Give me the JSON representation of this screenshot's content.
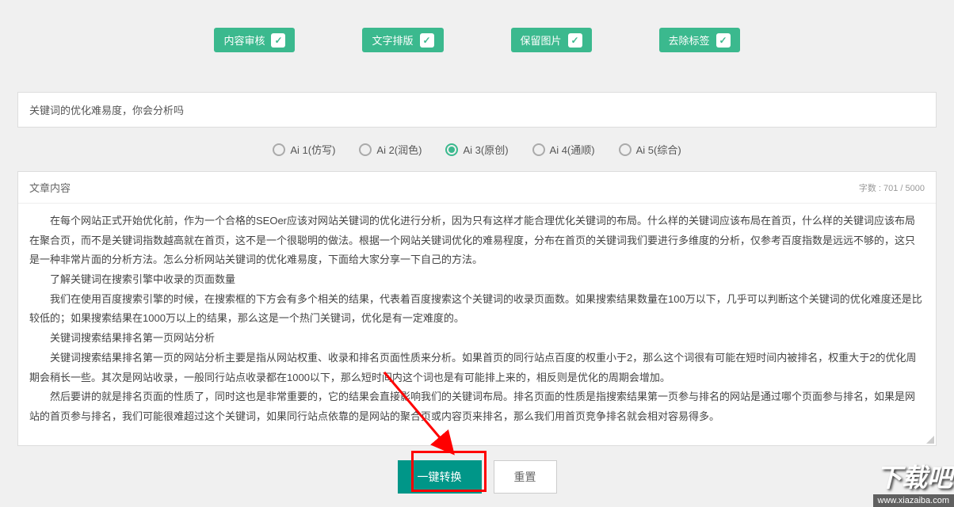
{
  "options": {
    "opt1": "内容审核",
    "opt2": "文字排版",
    "opt3": "保留图片",
    "opt4": "去除标签"
  },
  "title_input": "关键词的优化难易度，你会分析吗",
  "ai_modes": {
    "ai1": "Ai 1(仿写)",
    "ai2": "Ai 2(润色)",
    "ai3": "Ai 3(原创)",
    "ai4": "Ai 4(通顺)",
    "ai5": "Ai 5(综合)"
  },
  "content": {
    "header": "文章内容",
    "word_count": "字数 : 701 / 5000",
    "p1": "在每个网站正式开始优化前，作为一个合格的SEOer应该对网站关键词的优化进行分析，因为只有这样才能合理优化关键词的布局。什么样的关键词应该布局在首页，什么样的关键词应该布局在聚合页，而不是关键词指数越高就在首页，这不是一个很聪明的做法。根据一个网站关键词优化的难易程度，分布在首页的关键词我们要进行多维度的分析，仅参考百度指数是远远不够的，这只是一种非常片面的分析方法。怎么分析网站关键词的优化难易度，下面给大家分享一下自己的方法。",
    "p2": "了解关键词在搜索引擎中收录的页面数量",
    "p3": "我们在使用百度搜索引擎的时候，在搜索框的下方会有多个相关的结果，代表着百度搜索这个关键词的收录页面数。如果搜索结果数量在100万以下，几乎可以判断这个关键词的优化难度还是比较低的；如果搜索结果在1000万以上的结果，那么这是一个热门关键词，优化是有一定难度的。",
    "p4": "关键词搜索结果排名第一页网站分析",
    "p5": "关键词搜索结果排名第一页的网站分析主要是指从网站权重、收录和排名页面性质来分析。如果首页的同行站点百度的权重小于2，那么这个词很有可能在短时间内被排名，权重大于2的优化周期会稍长一些。其次是网站收录，一般同行站点收录都在1000以下，那么短时间内这个词也是有可能排上来的，相反则是优化的周期会增加。",
    "p6": "然后要讲的就是排名页面的性质了，同时这也是非常重要的，它的结果会直接影响我们的关键词布局。排名页面的性质是指搜索结果第一页参与排名的网站是通过哪个页面参与排名，如果是网站的首页参与排名，我们可能很难超过这个关键词，如果同行站点依靠的是网站的聚合页或内容页来排名，那么我们用首页竞争排名就会相对容易得多。"
  },
  "buttons": {
    "convert": "一键转换",
    "reset": "重置"
  },
  "watermark": {
    "logo": "下载吧",
    "url": "www.xiazaiba.com"
  }
}
